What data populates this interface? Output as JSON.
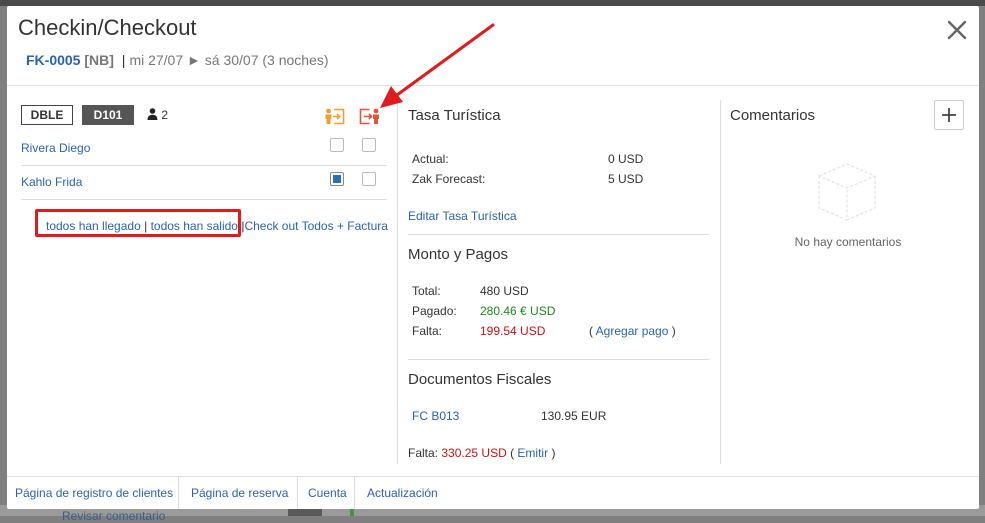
{
  "modal": {
    "title": "Checkin/Checkout",
    "booking_code": "FK-0005",
    "booking_tag": "[NB]",
    "separator": "|",
    "dates": "mi 27/07 ► sá 30/07 (3 noches)"
  },
  "left": {
    "room_type": "DBLE",
    "room_number": "D101",
    "guest_count": "2",
    "guests": [
      {
        "name": "Rivera Diego",
        "checked_in": false,
        "checked_out": false
      },
      {
        "name": "Kahlo Frida",
        "checked_in": true,
        "checked_out": false
      }
    ],
    "actions": {
      "all_arrived": "todos han llegado",
      "pipe": "|",
      "all_left": "todos han salido",
      "checkout_all": "Check out Todos + Factura"
    },
    "icons": {
      "checkin": "person-checkin-icon",
      "checkout": "person-checkout-icon"
    },
    "colors": {
      "checkin": "#f0a030",
      "checkout": "#e5533a"
    }
  },
  "tax": {
    "title": "Tasa Turística",
    "actual_label": "Actual:",
    "actual_value": "0 USD",
    "forecast_label": "Zak Forecast:",
    "forecast_value": "5 USD",
    "edit_link": "Editar Tasa Turística"
  },
  "payments": {
    "title": "Monto y Pagos",
    "total_label": "Total:",
    "total_value": "480 USD",
    "paid_label": "Pagado:",
    "paid_value": "280.46 € USD",
    "due_label": "Falta:",
    "due_value": "199.54 USD",
    "paren_open": "(",
    "add_payment": "Agregar pago",
    "paren_close": ")"
  },
  "fiscal": {
    "title": "Documentos Fiscales",
    "doc_code": "FC B013",
    "doc_amount": "130.95 EUR",
    "due_label": "Falta:",
    "due_value": "330.25 USD",
    "paren_open": "(",
    "emit": "Emitir",
    "paren_close": ")"
  },
  "comments": {
    "title": "Comentarios",
    "empty": "No hay comentarios"
  },
  "footer": {
    "tabs": [
      "Página de registro de clientes",
      "Página de reserva",
      "Cuenta",
      "Actualización"
    ]
  },
  "background": {
    "partial_text": "Revisar comentario"
  },
  "colors": {
    "link": "#2a63b4",
    "paid": "#1a8a1a",
    "due": "#d01010",
    "highlight": "#e01b1b"
  }
}
